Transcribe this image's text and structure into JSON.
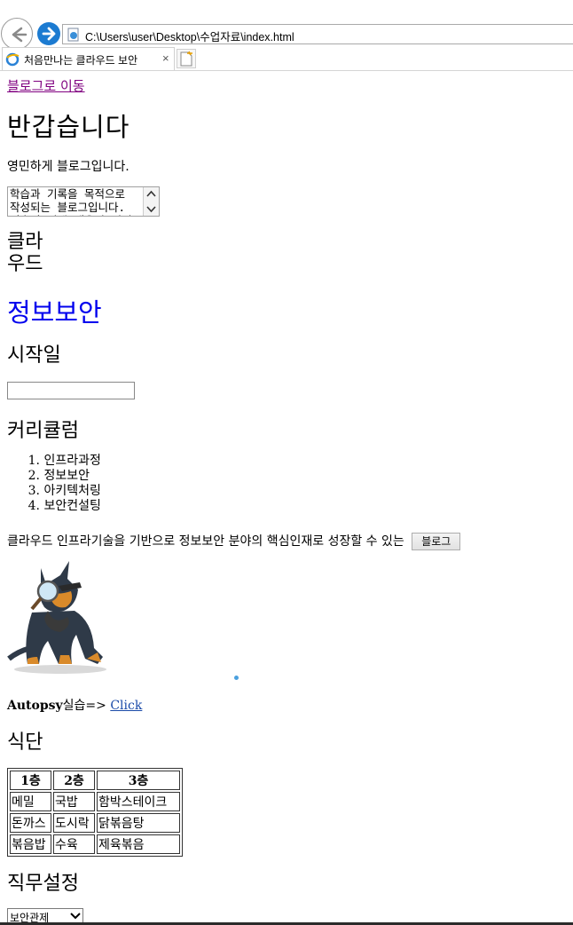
{
  "browser": {
    "address": "C:\\Users\\user\\Desktop\\수업자료\\index.html",
    "tab_title": "처음만나는 클라우드 보안",
    "tab_close": "×"
  },
  "page": {
    "blog_link": "블로그로 이동",
    "greeting": "반갑습니다",
    "intro": "영민하게 블로그입니다.",
    "description": "학습과 기록을 목적으로\n작성되는 블로그입니다.\n기술적 이해 내용의 일일",
    "cloud_heading": "클라우드",
    "infosec_heading": "정보보안",
    "start_label": "시작일",
    "start_value": "",
    "curriculum_title": "커리큘럼",
    "curriculum": [
      {
        "num": "1.",
        "label": "인프라과정"
      },
      {
        "num": "2.",
        "label": "정보보안"
      },
      {
        "num": "3.",
        "label": "아키텍처링"
      },
      {
        "num": "4.",
        "label": "보안컨설팅"
      }
    ],
    "mission": "클라우드 인프라기술을 기반으로 정보보안 분야의 핵심인재로 성장할 수 있는",
    "blog_button": "블로그",
    "autopsy_bold": "Autopsy",
    "autopsy_text": "실습=> ",
    "autopsy_link": "Click",
    "meal_title": "식단",
    "meal_table": {
      "headers": [
        "1층",
        "2층",
        "3층"
      ],
      "rows": [
        [
          "메밀",
          "국밥",
          "함박스테이크"
        ],
        [
          "돈까스",
          "도시락",
          "닭볶음탕"
        ],
        [
          "볶음밥",
          "수육",
          "제육볶음"
        ]
      ]
    },
    "job_title": "직무설정",
    "job_selected": "보안관제"
  },
  "icons": {
    "back": "back-arrow-icon",
    "forward": "forward-arrow-icon",
    "page": "ie-page-icon",
    "new_tab": "new-tab-icon",
    "dog": "detective-dog-image"
  },
  "colors": {
    "visited_link": "#800080",
    "link": "#0000ee",
    "forward_button": "#1c7bd1"
  }
}
